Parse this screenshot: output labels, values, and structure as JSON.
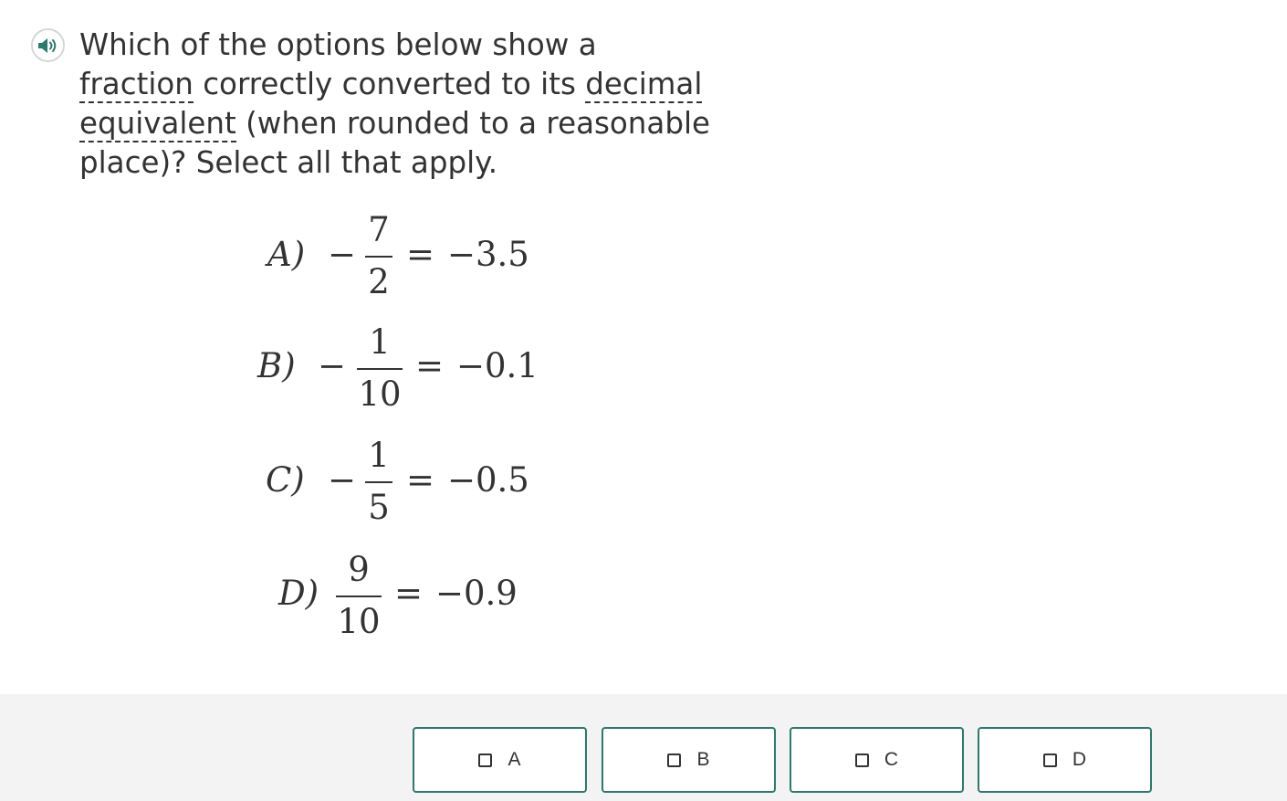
{
  "question": {
    "audio_icon": "speaker-icon",
    "text_1": "Which of the options below show a",
    "term_fraction": "fraction",
    "text_2": "correctly converted to its",
    "term_decimal": "decimal",
    "term_equivalent": "equivalent",
    "text_3": "(when rounded to a reasonable place)? Select all that apply."
  },
  "options": [
    {
      "letter": "A)",
      "sign": "−",
      "numerator": "7",
      "denominator": "2",
      "equals": "=",
      "result": "−3.5"
    },
    {
      "letter": "B)",
      "sign": "−",
      "numerator": "1",
      "denominator": "10",
      "equals": "=",
      "result": "−0.1"
    },
    {
      "letter": "C)",
      "sign": "−",
      "numerator": "1",
      "denominator": "5",
      "equals": "=",
      "result": "−0.5"
    },
    {
      "letter": "D)",
      "sign": "",
      "numerator": "9",
      "denominator": "10",
      "equals": "=",
      "result": "−0.9"
    }
  ],
  "choices": [
    {
      "label": "A"
    },
    {
      "label": "B"
    },
    {
      "label": "C"
    },
    {
      "label": "D"
    }
  ],
  "colors": {
    "accent": "#2a7a6e",
    "text": "#333333",
    "answer_bar": "#f3f3f3"
  }
}
